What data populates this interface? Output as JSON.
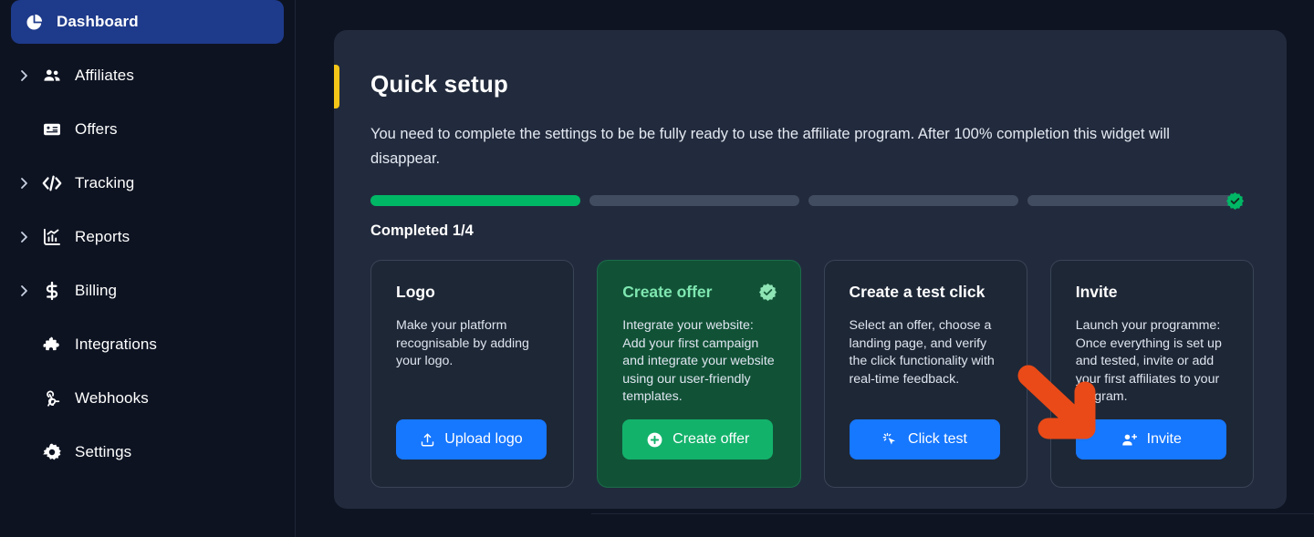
{
  "sidebar": {
    "items": [
      {
        "label": "Dashboard",
        "icon": "pie-chart-icon",
        "caret": false,
        "active": true
      },
      {
        "label": "Affiliates",
        "icon": "users-icon",
        "caret": true,
        "active": false
      },
      {
        "label": "Offers",
        "icon": "card-icon",
        "caret": false,
        "active": false
      },
      {
        "label": "Tracking",
        "icon": "code-icon",
        "caret": true,
        "active": false
      },
      {
        "label": "Reports",
        "icon": "bar-chart-icon",
        "caret": true,
        "active": false
      },
      {
        "label": "Billing",
        "icon": "dollar-icon",
        "caret": true,
        "active": false
      },
      {
        "label": "Integrations",
        "icon": "puzzle-icon",
        "caret": false,
        "active": false
      },
      {
        "label": "Webhooks",
        "icon": "webhook-icon",
        "caret": false,
        "active": false
      },
      {
        "label": "Settings",
        "icon": "gear-icon",
        "caret": false,
        "active": false
      }
    ]
  },
  "panel": {
    "title": "Quick setup",
    "description": "You need to complete the settings to be be fully ready to use the affiliate program. After 100% completion this widget will disappear.",
    "completed_label": "Completed 1/4",
    "accent_color": "#f5c518",
    "progress": {
      "total": 4,
      "completed": 1,
      "segments": [
        true,
        false,
        false,
        false
      ],
      "done_color": "#00b765",
      "track_color": "#424c60",
      "end_badge_icon": "check-badge-icon"
    }
  },
  "cards": [
    {
      "title": "Logo",
      "description": "Make your platform recognisable by adding your logo.",
      "button_label": "Upload logo",
      "button_icon": "upload-icon",
      "button_color": "#1677ff",
      "completed": false
    },
    {
      "title": "Create offer",
      "description": "Integrate your website: Add your first campaign and integrate your website using our user-friendly templates.",
      "button_label": "Create offer",
      "button_icon": "plus-circle-icon",
      "button_color": "#13b26b",
      "completed": true,
      "status_icon": "check-badge-icon"
    },
    {
      "title": "Create a test click",
      "description": "Select an offer, choose a landing page, and verify the click functionality with real-time feedback.",
      "button_label": "Click test",
      "button_icon": "cursor-sparkle-icon",
      "button_color": "#1677ff",
      "completed": false
    },
    {
      "title": "Invite",
      "description": "Launch your programme: Once everything is set up and tested, invite or add your first affiliates to your program.",
      "button_label": "Invite",
      "button_icon": "user-plus-icon",
      "button_color": "#1677ff",
      "completed": false
    }
  ],
  "annotation": {
    "arrow_icon": "pointer-arrow-icon",
    "arrow_color": "#ea4a17",
    "points_to": "Invite"
  }
}
